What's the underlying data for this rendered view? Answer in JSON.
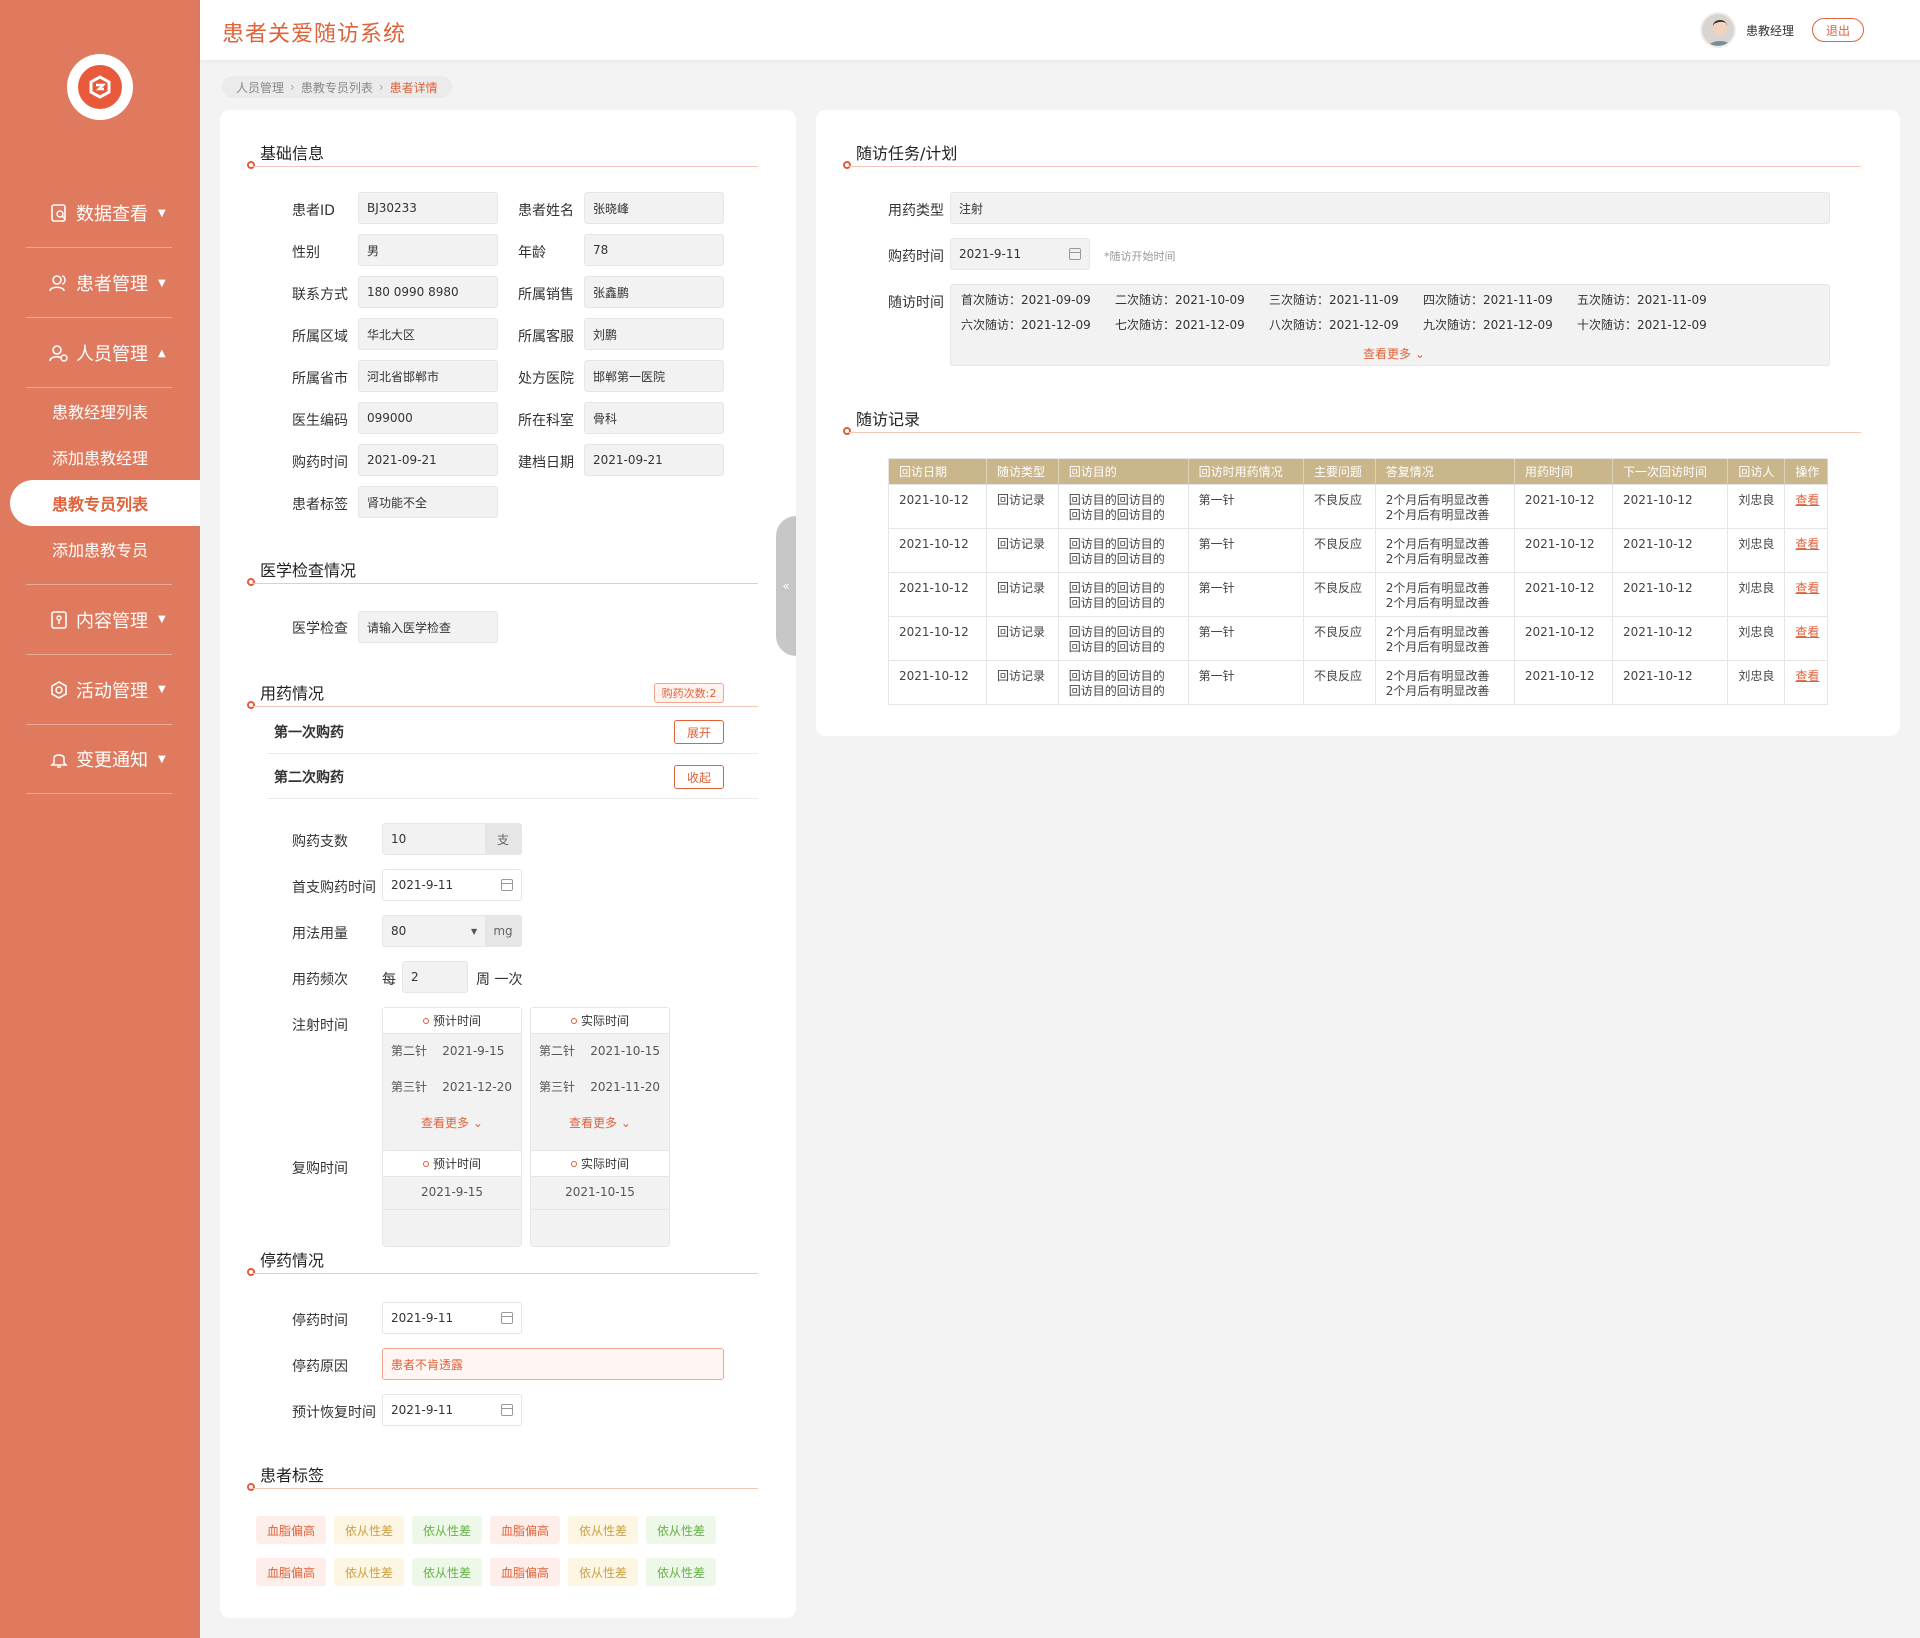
{
  "app": {
    "title": "患者关爱随访系统",
    "username": "患教经理",
    "logout": "退出"
  },
  "sidebar": {
    "items": [
      {
        "label": "数据查看"
      },
      {
        "label": "患者管理"
      },
      {
        "label": "人员管理"
      },
      {
        "label": "内容管理"
      },
      {
        "label": "活动管理"
      },
      {
        "label": "变更通知"
      }
    ],
    "subitems": [
      "患教经理列表",
      "添加患教经理",
      "患教专员列表",
      "添加患教专员"
    ]
  },
  "breadcrumb": [
    "人员管理",
    "患教专员列表",
    "患者详情"
  ],
  "basic": {
    "title": "基础信息",
    "fields": [
      {
        "label": "患者ID",
        "value": "BJ30233"
      },
      {
        "label": "患者姓名",
        "value": "张晓峰"
      },
      {
        "label": "性别",
        "value": "男"
      },
      {
        "label": "年龄",
        "value": "78"
      },
      {
        "label": "联系方式",
        "value": "180 0990 8980"
      },
      {
        "label": "所属销售",
        "value": "张鑫鹏"
      },
      {
        "label": "所属区域",
        "value": "华北大区"
      },
      {
        "label": "所属客服",
        "value": "刘鹏"
      },
      {
        "label": "所属省市",
        "value": "河北省邯郸市"
      },
      {
        "label": "处方医院",
        "value": "邯郸第一医院"
      },
      {
        "label": "医生编码",
        "value": "099000"
      },
      {
        "label": "所在科室",
        "value": "骨科"
      },
      {
        "label": "购药时间",
        "value": "2021-09-21"
      },
      {
        "label": "建档日期",
        "value": "2021-09-21"
      },
      {
        "label": "患者标签",
        "value": "肾功能不全"
      }
    ]
  },
  "medical": {
    "title": "医学检查情况",
    "label": "医学检查",
    "placeholder": "请输入医学检查"
  },
  "medication": {
    "title": "用药情况",
    "count_badge": "购药次数:2",
    "first": {
      "label": "第一次购药",
      "button": "展开"
    },
    "second": {
      "label": "第二次购药",
      "button": "收起"
    },
    "qty_label": "购药支数",
    "qty_value": "10",
    "qty_unit": "支",
    "first_time_label": "首支购药时间",
    "first_time_value": "2021-9-11",
    "dosage_label": "用法用量",
    "dosage_value": "80",
    "dosage_unit": "mg",
    "freq_label": "用药频次",
    "freq_prefix": "每",
    "freq_value": "2",
    "freq_suffix": "周 一次",
    "inject_label": "注射时间",
    "planned_header": "预计时间",
    "actual_header": "实际时间",
    "planned_rows": [
      {
        "n": "第二针",
        "d": "2021-9-15"
      },
      {
        "n": "第三针",
        "d": "2021-12-20"
      }
    ],
    "actual_rows": [
      {
        "n": "第二针",
        "d": "2021-10-15"
      },
      {
        "n": "第三针",
        "d": "2021-11-20"
      }
    ],
    "more": "查看更多",
    "rebuy_label": "复购时间",
    "rebuy_planned": "2021-9-15",
    "rebuy_actual": "2021-10-15"
  },
  "stop": {
    "title": "停药情况",
    "time_label": "停药时间",
    "time_value": "2021-9-11",
    "reason_label": "停药原因",
    "reason_value": "患者不肯透露",
    "recover_label": "预计恢复时间",
    "recover_value": "2021-9-11"
  },
  "tags": {
    "title": "患者标签",
    "items": [
      "血脂偏高",
      "依从性差",
      "依从性差",
      "血脂偏高",
      "依从性差",
      "依从性差",
      "血脂偏高",
      "依从性差",
      "依从性差",
      "血脂偏高",
      "依从性差",
      "依从性差"
    ],
    "colors": {
      "red": "#fdeee9",
      "red_text": "#e0623b",
      "yellow": "#fdf6e3",
      "yellow_text": "#c9a24a",
      "green": "#edf8e8",
      "green_text": "#6ab04c"
    }
  },
  "plan": {
    "title": "随访任务/计划",
    "type_label": "用药类型",
    "type_value": "注射",
    "buy_label": "购药时间",
    "buy_value": "2021-9-11",
    "buy_hint": "*随访开始时间",
    "followup_label": "随访时间",
    "schedule": [
      "首次随访：2021-09-09",
      "二次随访：2021-10-09",
      "三次随访：2021-11-09",
      "四次随访：2021-11-09",
      "五次随访：2021-11-09",
      "六次随访：2021-12-09",
      "七次随访：2021-12-09",
      "八次随访：2021-12-09",
      "九次随访：2021-12-09",
      "十次随访：2021-12-09"
    ],
    "more": "查看更多"
  },
  "records": {
    "title": "随访记录",
    "headers": [
      "回访日期",
      "随访类型",
      "回访目的",
      "回访时用药情况",
      "主要问题",
      "答复情况",
      "用药时间",
      "下一次回访时间",
      "回访人",
      "操作"
    ],
    "rows": [
      [
        "2021-10-12",
        "回访记录",
        "回访目的回访目的\n回访目的回访目的",
        "第一针",
        "不良反应",
        "2个月后有明显改善\n2个月后有明显改善",
        "2021-10-12",
        "2021-10-12",
        "刘忠良",
        "查看"
      ],
      [
        "2021-10-12",
        "回访记录",
        "回访目的回访目的\n回访目的回访目的",
        "第一针",
        "不良反应",
        "2个月后有明显改善\n2个月后有明显改善",
        "2021-10-12",
        "2021-10-12",
        "刘忠良",
        "查看"
      ],
      [
        "2021-10-12",
        "回访记录",
        "回访目的回访目的\n回访目的回访目的",
        "第一针",
        "不良反应",
        "2个月后有明显改善\n2个月后有明显改善",
        "2021-10-12",
        "2021-10-12",
        "刘忠良",
        "查看"
      ],
      [
        "2021-10-12",
        "回访记录",
        "回访目的回访目的\n回访目的回访目的",
        "第一针",
        "不良反应",
        "2个月后有明显改善\n2个月后有明显改善",
        "2021-10-12",
        "2021-10-12",
        "刘忠良",
        "查看"
      ],
      [
        "2021-10-12",
        "回访记录",
        "回访目的回访目的\n回访目的回访目的",
        "第一针",
        "不良反应",
        "2个月后有明显改善\n2个月后有明显改善",
        "2021-10-12",
        "2021-10-12",
        "刘忠良",
        "查看"
      ]
    ]
  }
}
